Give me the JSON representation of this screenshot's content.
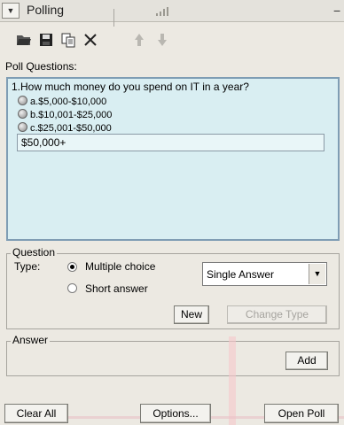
{
  "panel": {
    "title": "Polling"
  },
  "icons": {
    "collapse": "triangle-down-icon",
    "grip": "resize-grip-icon",
    "menu": "panel-menu-icon",
    "open": "open-folder-icon",
    "save": "save-icon",
    "copy": "copy-icon",
    "delete": "delete-x-icon",
    "move_up": "arrow-up-icon",
    "move_down": "arrow-down-icon"
  },
  "poll": {
    "label": "Poll Questions:",
    "question": "1.How much money do you spend on IT in a year?",
    "options": [
      "a.$5,000-$10,000",
      "b.$10,001-$25,000",
      "c.$25,001-$50,000"
    ],
    "new_answer_value": "$50,000+"
  },
  "question_group": {
    "label": "Question",
    "type_label": "Type:",
    "type_options": [
      "Multiple choice",
      "Short answer"
    ],
    "selected_type": "Multiple choice",
    "answer_mode": "Single Answer",
    "new_button": "New",
    "change_type_button": "Change Type"
  },
  "answer_group": {
    "label": "Answer",
    "add_button": "Add"
  },
  "footer": {
    "clear_all": "Clear All",
    "options": "Options...",
    "open_poll": "Open Poll"
  },
  "colors": {
    "list_bg": "#d9eef2",
    "list_border": "#7f9db4",
    "panel_bg": "#ece9e2"
  }
}
